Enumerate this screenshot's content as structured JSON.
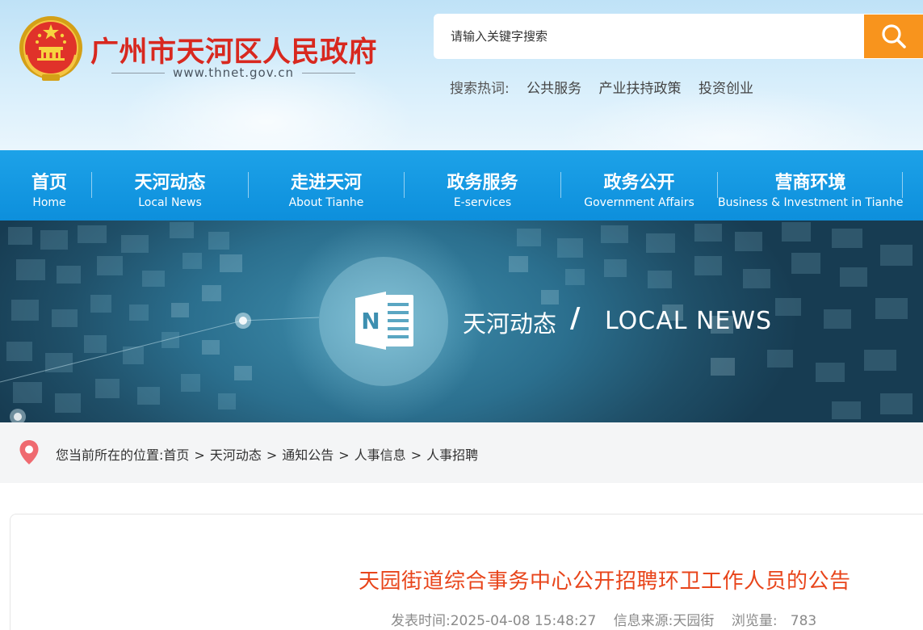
{
  "header": {
    "site_title": "广州市天河区人民政府",
    "site_domain": "www.thnet.gov.cn",
    "search": {
      "placeholder": "请输入关键字搜索",
      "hot_label": "搜索热词:",
      "hot_words": [
        "公共服务",
        "产业扶持政策",
        "投资创业"
      ]
    }
  },
  "nav": {
    "items": [
      {
        "cn": "首页",
        "en": "Home"
      },
      {
        "cn": "天河动态",
        "en": "Local News"
      },
      {
        "cn": "走进天河",
        "en": "About Tianhe"
      },
      {
        "cn": "政务服务",
        "en": "E-services"
      },
      {
        "cn": "政务公开",
        "en": "Government Affairs"
      },
      {
        "cn": "营商环境",
        "en": "Business & Investment in Tianhe"
      }
    ]
  },
  "banner": {
    "icon_letter": "N",
    "title_cn": "天河动态",
    "slash": "/",
    "title_en": "LOCAL NEWS"
  },
  "breadcrumb": {
    "label": "您当前所在的位置:",
    "separator": ">",
    "items": [
      "首页",
      "天河动态",
      "通知公告",
      "人事信息",
      "人事招聘"
    ]
  },
  "article": {
    "title": "天园街道综合事务中心公开招聘环卫工作人员的公告",
    "publish_time": "发表时间:2025-04-08 15:48:27",
    "source": "信息来源:天园街",
    "views": "浏览量:   783"
  },
  "colors": {
    "brand_red": "#d8281f",
    "nav_blue": "#1da2e8",
    "search_orange": "#f8941d",
    "title_orange": "#e8451b"
  }
}
